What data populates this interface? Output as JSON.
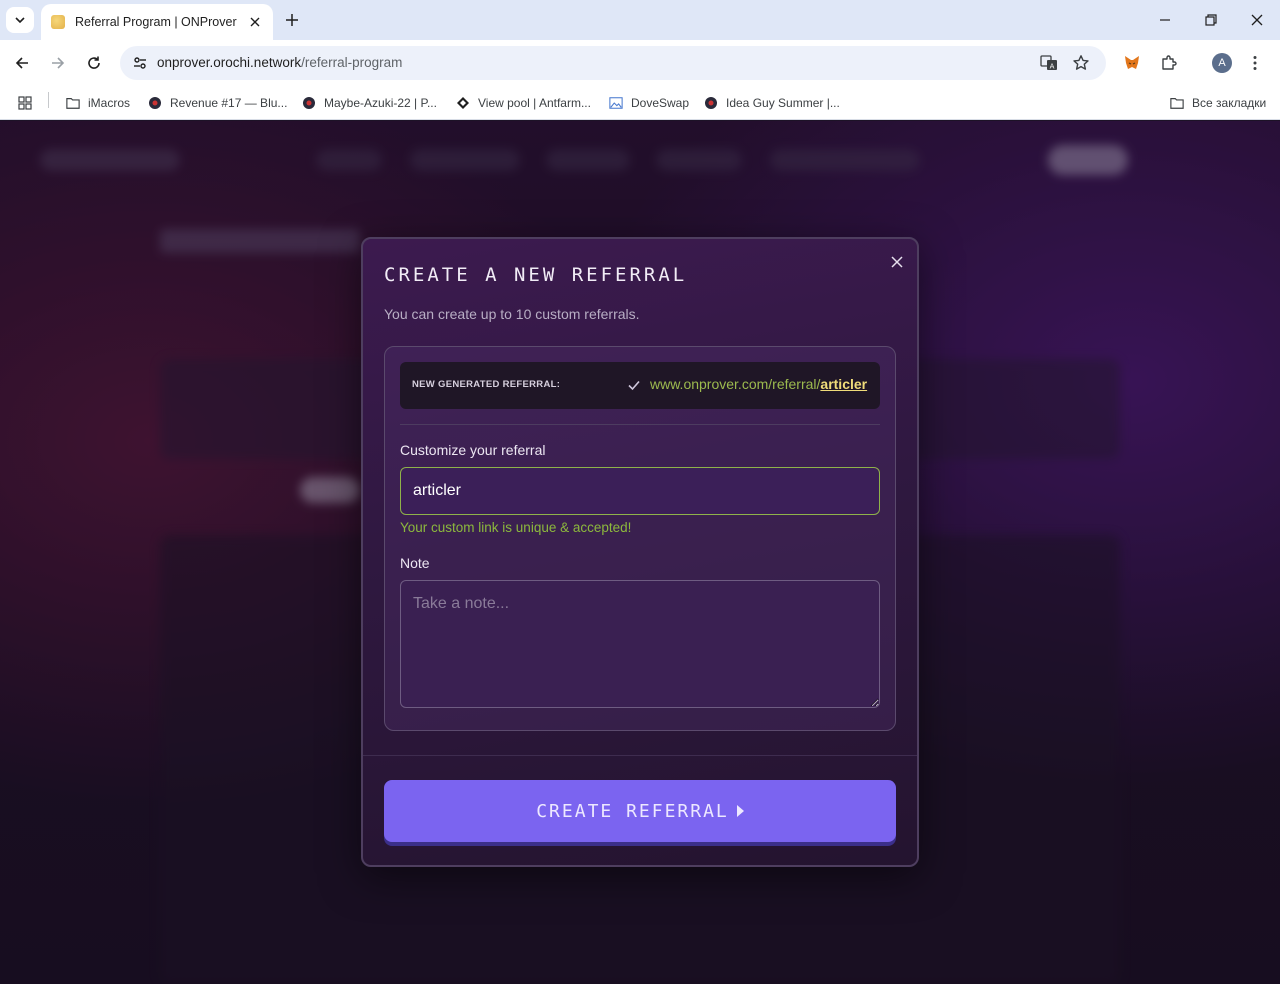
{
  "browser": {
    "tab": {
      "title": "Referral Program | ONProver"
    },
    "url": {
      "host": "onprover.orochi.network",
      "path": "/referral-program"
    },
    "profile_initial": "A",
    "bookmarks": [
      {
        "label": "iMacros",
        "icon": "folder-icon"
      },
      {
        "label": "Revenue #17 — Blu...",
        "icon": "site-favicon"
      },
      {
        "label": "Maybe-Azuki-22 | P...",
        "icon": "site-favicon"
      },
      {
        "label": "View pool | Antfarm...",
        "icon": "antfarm-icon"
      },
      {
        "label": "DoveSwap",
        "icon": "image-icon"
      },
      {
        "label": "Idea Guy Summer |...",
        "icon": "site-favicon"
      }
    ],
    "all_bookmarks_label": "Все закладки"
  },
  "modal": {
    "title": "CREATE A NEW REFERRAL",
    "subtitle": "You can create up to 10 custom referrals.",
    "generated": {
      "label": "NEW GENERATED REFERRAL:",
      "url_prefix": "www.onprover.com/referral/",
      "slug": "articler"
    },
    "customize": {
      "label": "Customize your referral",
      "value": "articler",
      "validation": "Your custom link is unique & accepted!"
    },
    "note": {
      "label": "Note",
      "placeholder": "Take a note..."
    },
    "submit_label": "CREATE REFERRAL"
  },
  "colors": {
    "accent_button": "#7b64f0",
    "success": "#8cb83d",
    "slug_highlight": "#f0dc7a"
  }
}
